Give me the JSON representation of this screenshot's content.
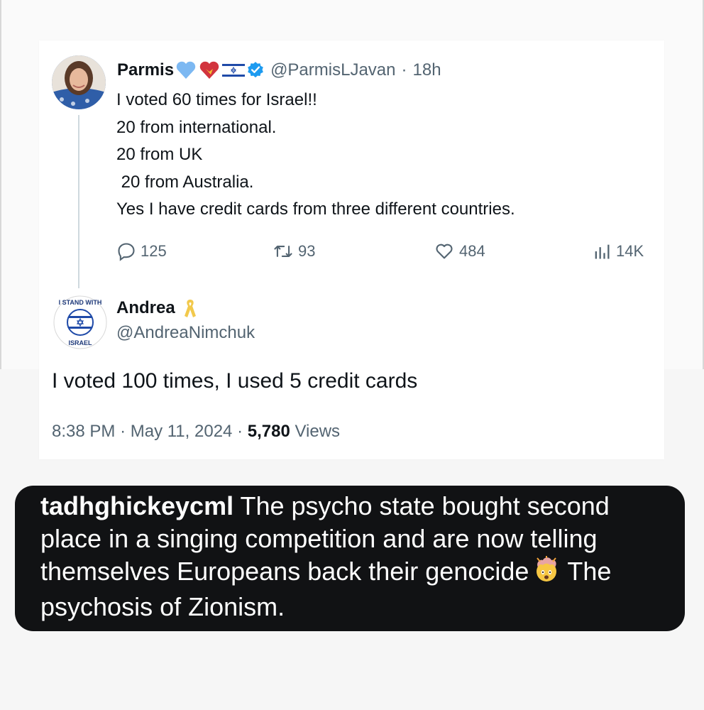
{
  "original_tweet": {
    "display_name": "Parmis",
    "handle": "@ParmisLJavan",
    "separator": "·",
    "time_ago": "18h",
    "lines": [
      "I voted 60 times for Israel!!",
      "20 from international.",
      "20 from UK",
      " 20 from Australia.",
      "Yes I have credit cards from three different countries."
    ],
    "actions": {
      "replies": "125",
      "reposts": "93",
      "likes": "484",
      "views": "14K"
    },
    "name_icons": [
      "blue-heart-icon",
      "heart-with-ribbon-icon",
      "israel-flag-icon",
      "verified-badge-icon"
    ]
  },
  "reply_tweet": {
    "display_name": "Andrea",
    "handle": "@AndreaNimchuk",
    "name_icon": "yellow-ribbon-icon",
    "text": "I voted 100 times, I used 5 credit cards",
    "time": "8:38 PM",
    "dot1": "·",
    "date": "May 11, 2024",
    "dot2": "·",
    "views_count": "5,780",
    "views_label": "Views",
    "avatar_badge_top": "I STAND WITH",
    "avatar_badge_bottom": "ISRAEL"
  },
  "caption": {
    "username": "tadhghickeycml",
    "text_before_emoji": "The psycho state bought second place in a singing competition and are now telling themselves Europeans back their genocide",
    "emoji": "exploding-head-icon",
    "text_after_emoji": "The psychosis of Zionism."
  },
  "colors": {
    "text_primary": "#0f1419",
    "text_secondary": "#536471",
    "verified_blue": "#1d9bf0",
    "caption_bg": "#111214"
  }
}
